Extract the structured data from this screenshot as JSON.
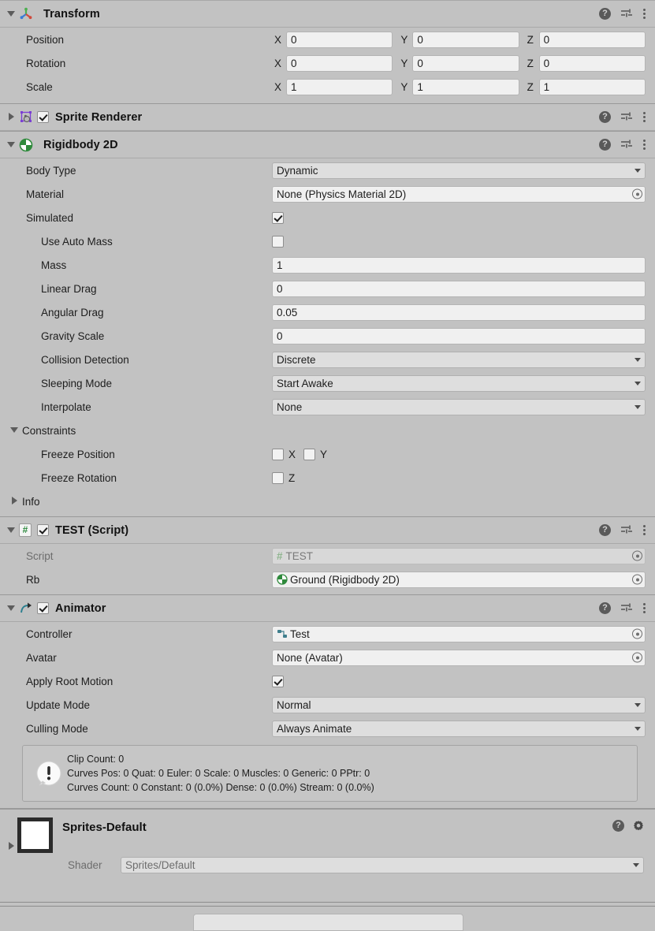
{
  "panel": {
    "name": "Unity Inspector"
  },
  "header_icons": {
    "help": "help-icon",
    "preset": "preset-icon",
    "menu": "more-menu-icon",
    "gear": "gear-icon"
  },
  "components": [
    {
      "id": "transform",
      "title": "Transform",
      "icon": "transform-gizmo-icon",
      "expanded": true,
      "has_enable_checkbox": false,
      "rows": [
        {
          "label": "Position",
          "axes": [
            "X",
            "Y",
            "Z"
          ],
          "values": [
            "0",
            "0",
            "0"
          ]
        },
        {
          "label": "Rotation",
          "axes": [
            "X",
            "Y",
            "Z"
          ],
          "values": [
            "0",
            "0",
            "0"
          ]
        },
        {
          "label": "Scale",
          "axes": [
            "X",
            "Y",
            "Z"
          ],
          "values": [
            "1",
            "1",
            "1"
          ]
        }
      ]
    },
    {
      "id": "sprite-renderer",
      "title": "Sprite Renderer",
      "icon": "sprite-renderer-icon",
      "expanded": false,
      "has_enable_checkbox": true,
      "enabled": true
    },
    {
      "id": "rigidbody-2d",
      "title": "Rigidbody 2D",
      "icon": "rigidbody-2d-icon",
      "expanded": true,
      "has_enable_checkbox": false,
      "fields": [
        {
          "label": "Body Type",
          "kind": "popup",
          "value": "Dynamic"
        },
        {
          "label": "Material",
          "kind": "object",
          "value": "None (Physics Material 2D)"
        },
        {
          "label": "Simulated",
          "kind": "checkbox",
          "checked": true
        },
        {
          "label": "Use Auto Mass",
          "kind": "checkbox",
          "checked": false,
          "indent": 3
        },
        {
          "label": "Mass",
          "kind": "text",
          "value": "1",
          "indent": 3
        },
        {
          "label": "Linear Drag",
          "kind": "text",
          "value": "0",
          "indent": 3
        },
        {
          "label": "Angular Drag",
          "kind": "text",
          "value": "0.05",
          "indent": 3
        },
        {
          "label": "Gravity Scale",
          "kind": "text",
          "value": "0",
          "indent": 3
        },
        {
          "label": "Collision Detection",
          "kind": "popup",
          "value": "Discrete",
          "indent": 3
        },
        {
          "label": "Sleeping Mode",
          "kind": "popup",
          "value": "Start Awake",
          "indent": 3
        },
        {
          "label": "Interpolate",
          "kind": "popup",
          "value": "None",
          "indent": 3
        }
      ],
      "constraints": {
        "label": "Constraints",
        "expanded": true,
        "freeze_position": {
          "label": "Freeze Position",
          "axes": [
            "X",
            "Y"
          ],
          "checked": [
            false,
            false
          ]
        },
        "freeze_rotation": {
          "label": "Freeze Rotation",
          "axes": [
            "Z"
          ],
          "checked": [
            false
          ]
        }
      },
      "info": {
        "label": "Info",
        "expanded": false
      }
    },
    {
      "id": "test-script",
      "title": "TEST (Script)",
      "icon": "csharp-script-icon",
      "expanded": true,
      "has_enable_checkbox": true,
      "enabled": true,
      "fields": [
        {
          "label": "Script",
          "kind": "object",
          "value": "TEST",
          "disabled": true,
          "value_icon": "csharp-script-icon"
        },
        {
          "label": "Rb",
          "kind": "object",
          "value": "Ground (Rigidbody 2D)",
          "value_icon": "rigidbody-2d-icon"
        }
      ]
    },
    {
      "id": "animator",
      "title": "Animator",
      "icon": "animator-icon",
      "expanded": true,
      "has_enable_checkbox": true,
      "enabled": true,
      "fields": [
        {
          "label": "Controller",
          "kind": "object",
          "value": "Test",
          "value_icon": "animator-controller-icon"
        },
        {
          "label": "Avatar",
          "kind": "object",
          "value": "None (Avatar)"
        },
        {
          "label": "Apply Root Motion",
          "kind": "checkbox",
          "checked": true
        },
        {
          "label": "Update Mode",
          "kind": "popup",
          "value": "Normal"
        },
        {
          "label": "Culling Mode",
          "kind": "popup",
          "value": "Always Animate"
        }
      ],
      "help_box": {
        "icon": "info-warning-icon",
        "lines": [
          "Clip Count: 0",
          "Curves Pos: 0 Quat: 0 Euler: 0 Scale: 0 Muscles: 0 Generic: 0 PPtr: 0",
          "Curves Count: 0 Constant: 0 (0.0%) Dense: 0 (0.0%) Stream: 0 (0.0%)"
        ]
      }
    }
  ],
  "material": {
    "name": "Sprites-Default",
    "swatch_color": "#ffffff",
    "shader_label": "Shader",
    "shader_value": "Sprites/Default"
  },
  "colors": {
    "panel_bg": "#c2c2c2",
    "field_bg": "#f0f0f0",
    "popup_bg": "#dedede",
    "rigidbody_green": "#2f8a3c",
    "sprite_purple": "#7b3fd4",
    "script_green": "#2d8a3e",
    "animator_teal": "#2b7f8f",
    "axis_green": "#4caf50",
    "axis_red": "#d04a3c",
    "axis_blue": "#3a7bd5"
  }
}
